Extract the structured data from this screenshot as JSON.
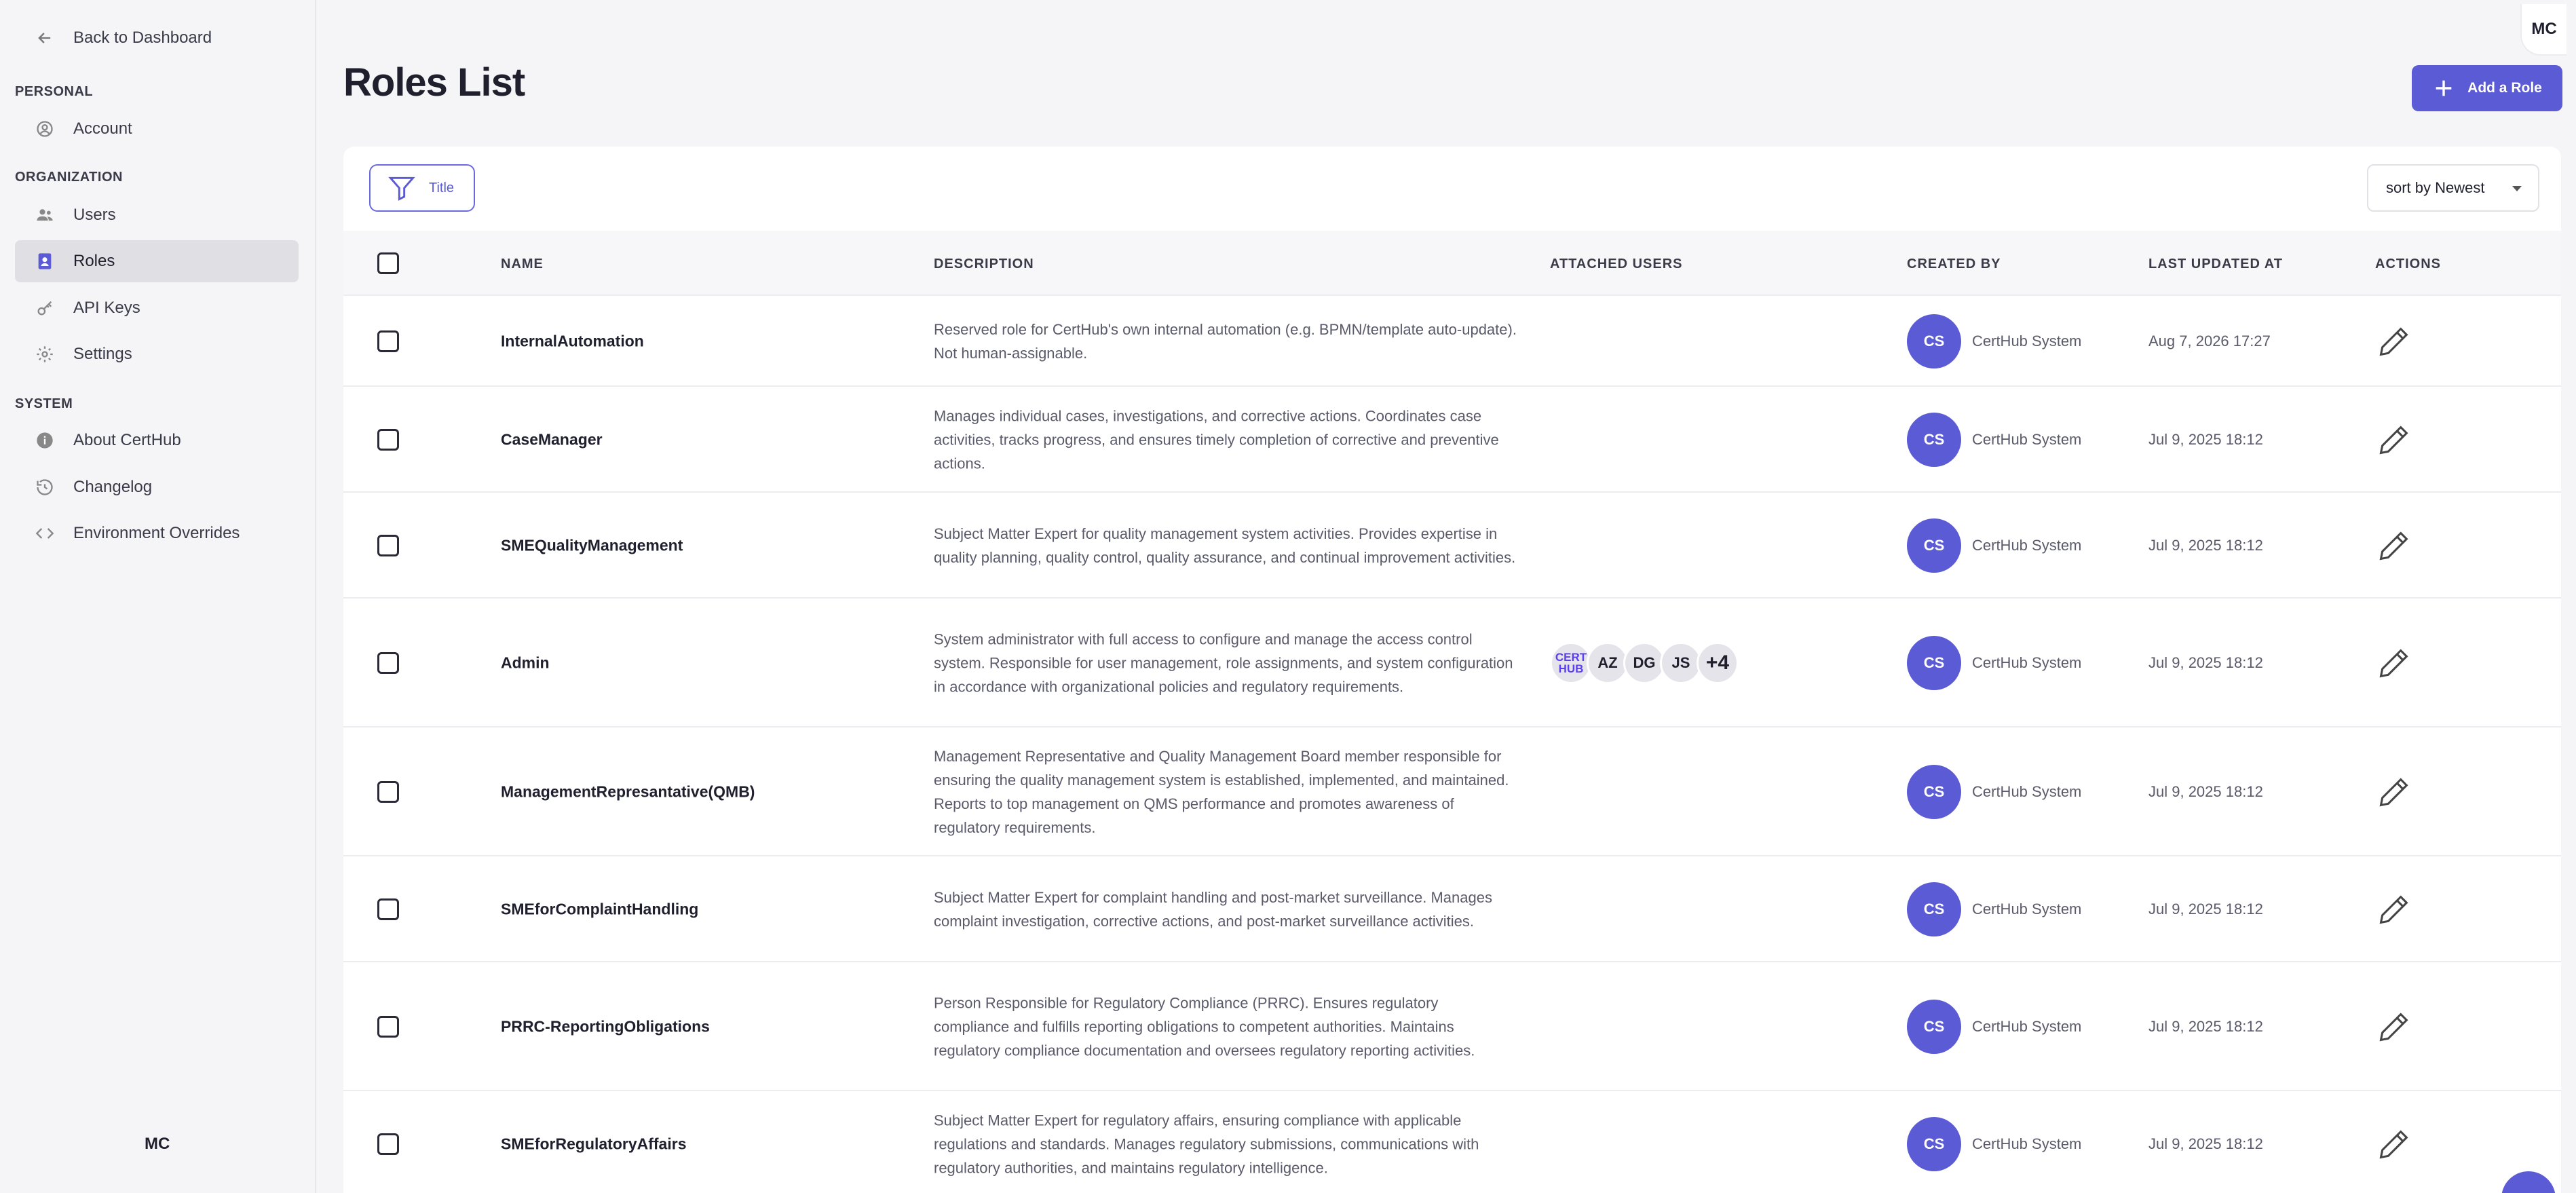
{
  "sidebar": {
    "back_label": "Back to Dashboard",
    "sections": {
      "personal": "PERSONAL",
      "organization": "ORGANIZATION",
      "system": "SYSTEM"
    },
    "items": {
      "account": "Account",
      "users": "Users",
      "roles": "Roles",
      "api_keys": "API Keys",
      "settings": "Settings",
      "about": "About CertHub",
      "changelog": "Changelog",
      "env_overrides": "Environment Overrides"
    },
    "active_item": "roles",
    "user_initials": "MC"
  },
  "header": {
    "avatar_initials": "MC",
    "title": "Roles List",
    "add_button": "Add a Role"
  },
  "toolbar": {
    "filter_label": "Title",
    "sort_value": "sort by Newest"
  },
  "table": {
    "columns": {
      "name": "NAME",
      "description": "DESCRIPTION",
      "attached_users": "ATTACHED USERS",
      "created_by": "CREATED BY",
      "last_updated": "LAST UPDATED AT",
      "actions": "ACTIONS"
    },
    "rows": [
      {
        "name": "InternalAutomation",
        "description": "Reserved role for CertHub's own internal automation (e.g. BPMN/template auto-update). Not human-assignable.",
        "creator_initials": "CS",
        "creator": "CertHub System",
        "updated": "Aug 7, 2026 17:27"
      },
      {
        "name": "CaseManager",
        "description": "Manages individual cases, investigations, and corrective actions. Coordinates case activities, tracks progress, and ensures timely completion of corrective and preventive actions.",
        "creator_initials": "CS",
        "creator": "CertHub System",
        "updated": "Jul 9, 2025 18:12"
      },
      {
        "name": "SMEQualityManagement",
        "description": "Subject Matter Expert for quality management system activities. Provides expertise in quality planning, quality control, quality assurance, and continual improvement activities.",
        "creator_initials": "CS",
        "creator": "CertHub System",
        "updated": "Jul 9, 2025 18:12"
      },
      {
        "name": "Admin",
        "description": "System administrator with full access to configure and manage the access control system. Responsible for user management, role assignments, and system configuration in accordance with organizational policies and regulatory requirements.",
        "attached_users": [
          "CERT HUB",
          "AZ",
          "DG",
          "JS",
          "+4"
        ],
        "creator_initials": "CS",
        "creator": "CertHub System",
        "updated": "Jul 9, 2025 18:12"
      },
      {
        "name": "ManagementRepresantative(QMB)",
        "description": "Management Representative and Quality Management Board member responsible for ensuring the quality management system is established, implemented, and maintained. Reports to top management on QMS performance and promotes awareness of regulatory requirements.",
        "creator_initials": "CS",
        "creator": "CertHub System",
        "updated": "Jul 9, 2025 18:12"
      },
      {
        "name": "SMEforComplaintHandling",
        "description": "Subject Matter Expert for complaint handling and post-market surveillance. Manages complaint investigation, corrective actions, and post-market surveillance activities.",
        "creator_initials": "CS",
        "creator": "CertHub System",
        "updated": "Jul 9, 2025 18:12"
      },
      {
        "name": "PRRC-ReportingObligations",
        "description": "Person Responsible for Regulatory Compliance (PRRC). Ensures regulatory compliance and fulfills reporting obligations to competent authorities. Maintains regulatory compliance documentation and oversees regulatory reporting activities.",
        "creator_initials": "CS",
        "creator": "CertHub System",
        "updated": "Jul 9, 2025 18:12"
      },
      {
        "name": "SMEforRegulatoryAffairs",
        "description": "Subject Matter Expert for regulatory affairs, ensuring compliance with applicable regulations and standards. Manages regulatory submissions, communications with regulatory authorities, and maintains regulatory intelligence.",
        "creator_initials": "CS",
        "creator": "CertHub System",
        "updated": "Jul 9, 2025 18:12"
      }
    ]
  },
  "colors": {
    "accent": "#5b5bd6",
    "background": "#f5f5f7",
    "active_nav": "#e0e0e4"
  }
}
